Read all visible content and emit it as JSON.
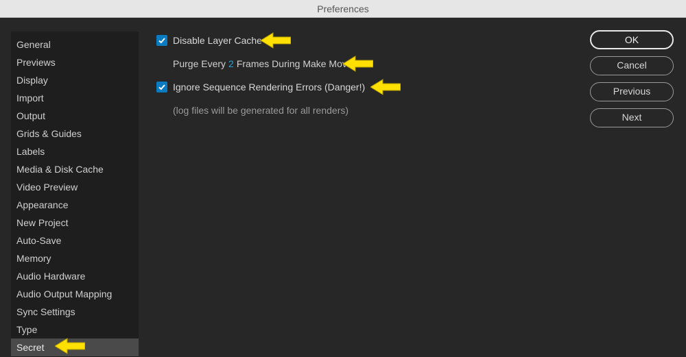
{
  "window": {
    "title": "Preferences"
  },
  "sidebar": {
    "items": [
      {
        "label": "General"
      },
      {
        "label": "Previews"
      },
      {
        "label": "Display"
      },
      {
        "label": "Import"
      },
      {
        "label": "Output"
      },
      {
        "label": "Grids & Guides"
      },
      {
        "label": "Labels"
      },
      {
        "label": "Media & Disk Cache"
      },
      {
        "label": "Video Preview"
      },
      {
        "label": "Appearance"
      },
      {
        "label": "New Project"
      },
      {
        "label": "Auto-Save"
      },
      {
        "label": "Memory"
      },
      {
        "label": "Audio Hardware"
      },
      {
        "label": "Audio Output Mapping"
      },
      {
        "label": "Sync Settings"
      },
      {
        "label": "Type"
      },
      {
        "label": "Secret"
      }
    ],
    "selected_index": 17
  },
  "main": {
    "check1_label": "Disable Layer Cache",
    "purge_before": "Purge Every",
    "purge_value": "2",
    "purge_after": "Frames During Make Movie",
    "check2_label": "Ignore Sequence Rendering Errors (Danger!)",
    "hint": "(log files will be generated for all renders)"
  },
  "buttons": {
    "ok": "OK",
    "cancel": "Cancel",
    "previous": "Previous",
    "next": "Next"
  },
  "colors": {
    "accent_checkbox": "#0b7bc1",
    "arrow": "#ffe000"
  }
}
